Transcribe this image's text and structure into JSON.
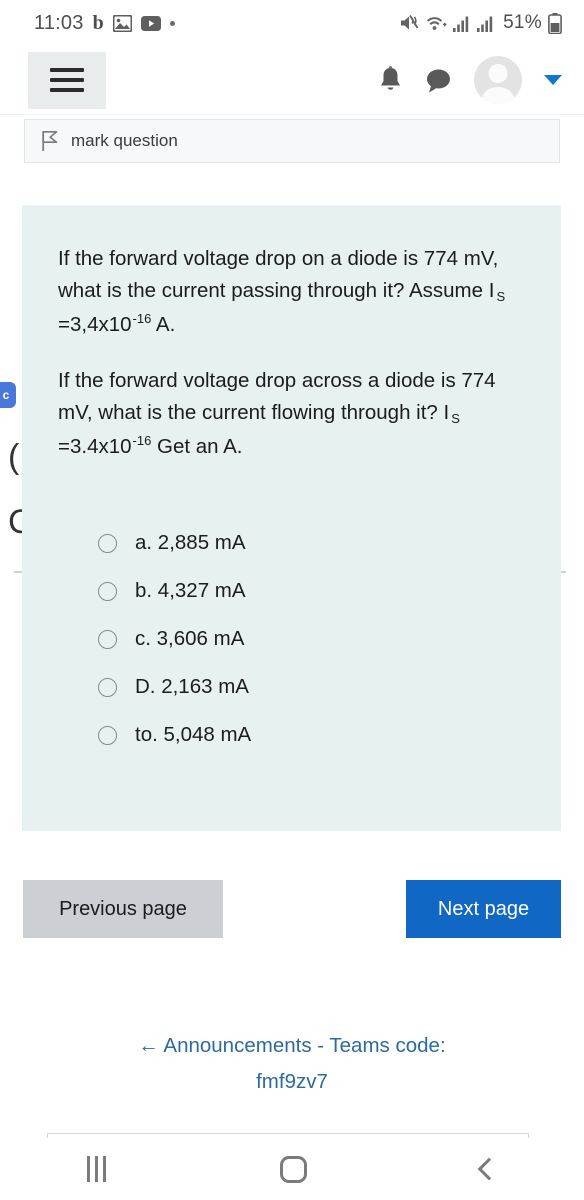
{
  "status_bar": {
    "time": "11:03",
    "left_icons": [
      "b-letter-icon",
      "image-icon",
      "youtube-icon",
      "dot-icon"
    ],
    "right_icons": [
      "mute-icon",
      "wifi-plus-icon",
      "signal-bars-icon",
      "signal-bars-icon",
      "battery-icon"
    ],
    "battery_percent": "51%"
  },
  "header": {
    "menu_icon": "hamburger-menu-icon",
    "bell_icon": "notification-bell-icon",
    "chat_icon": "chat-bubble-icon",
    "avatar_icon": "user-avatar",
    "caret_icon": "chevron-down-icon",
    "accent_color": "#1177cc"
  },
  "mark_bar": {
    "icon": "flag-outline-icon",
    "label": "mark question"
  },
  "edge_artifacts": {
    "badge_letter": "c",
    "glyph_1": "(",
    "glyph_2": "C"
  },
  "question": {
    "card_bg": "#e7f1f2",
    "paragraph_1": {
      "part_a": "If the forward voltage drop on a diode is 774 mV, what is the current passing through it? Assume I",
      "sub": "S",
      "part_b": " =3,4x10",
      "sup": "-16",
      "part_c": " A."
    },
    "paragraph_2": {
      "part_a": "If the forward voltage drop across a diode is 774 mV, what is the current flowing through it? I",
      "sub": "S",
      "part_b": " =3.4x10",
      "sup": "-16",
      "part_c": " Get an A."
    },
    "options": [
      {
        "label": "a. 2,885 mA",
        "selected": false
      },
      {
        "label": "b. 4,327 mA",
        "selected": false
      },
      {
        "label": "c. 3,606 mA",
        "selected": false
      },
      {
        "label": "D. 2,163 mA",
        "selected": false
      },
      {
        "label": "to. 5,048 mA",
        "selected": false
      }
    ]
  },
  "navigation": {
    "previous_label": "Previous page",
    "next_label": "Next page",
    "previous_color": "#ccd0d4",
    "next_color": "#1068c4"
  },
  "announcement": {
    "line_1": "← Announcements - Teams code:",
    "line_2": "fmf9zv7",
    "color": "#2c6ba0"
  },
  "system_nav": {
    "recent_icon": "recent-apps-icon",
    "home_icon": "home-icon",
    "back_icon": "back-icon"
  }
}
